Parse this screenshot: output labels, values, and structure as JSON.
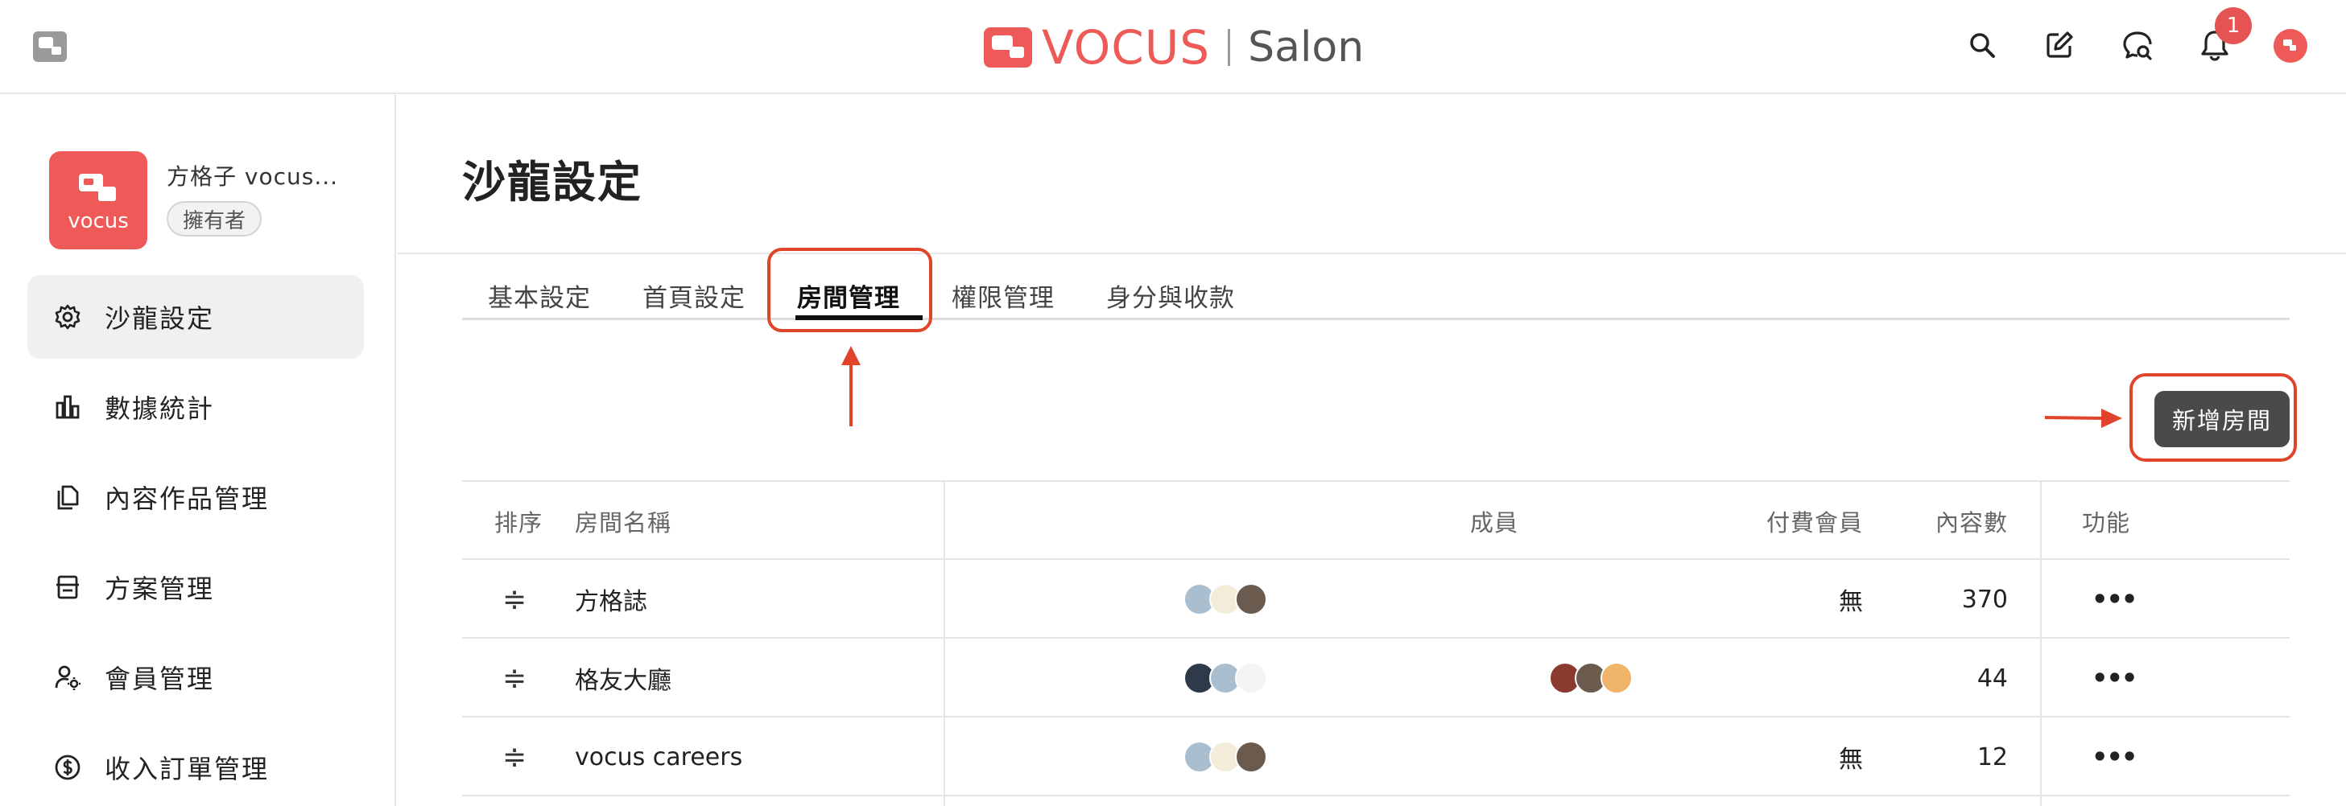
{
  "header": {
    "brand_word": "VOCUS",
    "brand_product": "Salon",
    "notification_count": "1",
    "icons": [
      "search-icon",
      "compose-icon",
      "chat-icon",
      "bell-icon",
      "user-avatar"
    ]
  },
  "sidebar": {
    "salon_name": "方格子 vocus...",
    "salon_logo_text": "vocus",
    "role_badge": "擁有者",
    "items": [
      {
        "label": "沙龍設定",
        "icon": "gear-icon",
        "active": true
      },
      {
        "label": "數據統計",
        "icon": "bar-chart-icon",
        "active": false
      },
      {
        "label": "內容作品管理",
        "icon": "documents-icon",
        "active": false
      },
      {
        "label": "方案管理",
        "icon": "plan-icon",
        "active": false
      },
      {
        "label": "會員管理",
        "icon": "member-settings-icon",
        "active": false
      },
      {
        "label": "收入訂單管理",
        "icon": "dollar-icon",
        "active": false
      }
    ]
  },
  "main": {
    "title": "沙龍設定",
    "tabs": [
      {
        "label": "基本設定",
        "active": false
      },
      {
        "label": "首頁設定",
        "active": false
      },
      {
        "label": "房間管理",
        "active": true
      },
      {
        "label": "權限管理",
        "active": false
      },
      {
        "label": "身分與收款",
        "active": false
      }
    ],
    "add_room_button": "新增房間",
    "table": {
      "columns": [
        "排序",
        "房間名稱",
        "成員",
        "付費會員",
        "內容數",
        "功能"
      ],
      "drag_glyph": "≑",
      "rows": [
        {
          "name": "方格誌",
          "paid_members": "無",
          "content_count": "370",
          "action": "•••"
        },
        {
          "name": "格友大廳",
          "paid_members": "",
          "content_count": "44",
          "action": "•••"
        },
        {
          "name": "vocus careers",
          "paid_members": "無",
          "content_count": "12",
          "action": "•••"
        }
      ]
    }
  },
  "colors": {
    "brand": "#ee5a57",
    "annotation": "#e0452c",
    "button_bg": "#4b4a48",
    "active_nav_bg": "#f1f0ee",
    "badge": "#e55353"
  }
}
